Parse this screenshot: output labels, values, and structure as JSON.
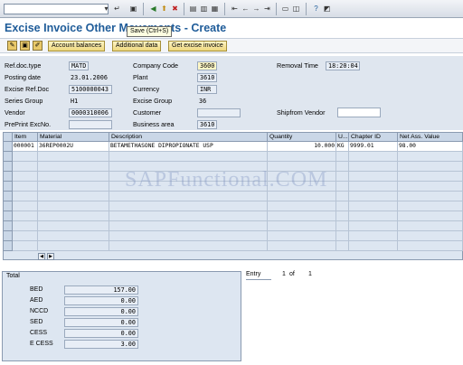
{
  "systoolbar": {
    "command_field": "",
    "icons": [
      "enter-icon",
      "save-icon",
      "back-icon",
      "exit-icon",
      "cancel-icon",
      "print-icon",
      "find-icon",
      "find-next-icon",
      "first-page-icon",
      "prev-page-icon",
      "next-page-icon",
      "last-page-icon",
      "new-session-icon",
      "shortcut-icon",
      "help-icon",
      "layout-icon"
    ]
  },
  "title": "Excise Invoice Other Movements - Create",
  "tooltip": "Save  (Ctrl+S)",
  "apptoolbar": {
    "account_balances": "Account balances",
    "additional_data": "Additional data",
    "get_excise_invoice": "Get excise invoice"
  },
  "header": {
    "ref_doc_type_label": "Ref.doc.type",
    "ref_doc_type": "MATD",
    "posting_date_label": "Posting date",
    "posting_date": "23.01.2006",
    "excise_ref_doc_label": "Excise Ref.Doc",
    "excise_ref_doc": "5100000043",
    "series_group_label": "Series Group",
    "series_group": "H1",
    "vendor_label": "Vendor",
    "vendor": "0000310006",
    "preprint_label": "PrePrint ExcNo.",
    "preprint": "",
    "company_code_label": "Company Code",
    "company_code": "3600",
    "plant_label": "Plant",
    "plant": "3610",
    "currency_label": "Currency",
    "currency": "INR",
    "excise_group_label": "Excise Group",
    "excise_group": "36",
    "customer_label": "Customer",
    "customer": "",
    "business_area_label": "Business area",
    "business_area": "3610",
    "removal_time_label": "Removal Time",
    "removal_time": "18:20:04",
    "shipfrom_vendor_label": "Shipfrom Vendor",
    "shipfrom_vendor": ""
  },
  "table": {
    "columns": [
      "Item",
      "Material",
      "Description",
      "Quantity",
      "U...",
      "Chapter ID",
      "Net Ass. Value"
    ],
    "rows": [
      [
        "000001",
        "36REP0002U",
        "BETAMETHASONE DIPROPIONATE USP",
        "10.000",
        "KG",
        "9999.01",
        "98.00"
      ]
    ]
  },
  "watermark": "SAPFunctional.COM",
  "totals": {
    "title": "Total",
    "items": [
      {
        "label": "BED",
        "value": "157.00"
      },
      {
        "label": "AED",
        "value": "0.00"
      },
      {
        "label": "NCCD",
        "value": "0.00"
      },
      {
        "label": "SED",
        "value": "0.00"
      },
      {
        "label": "CESS",
        "value": "0.00"
      },
      {
        "label": "E CESS",
        "value": "3.00"
      }
    ]
  },
  "entry": {
    "label": "Entry",
    "current": "1",
    "of": "of",
    "total": "1"
  }
}
